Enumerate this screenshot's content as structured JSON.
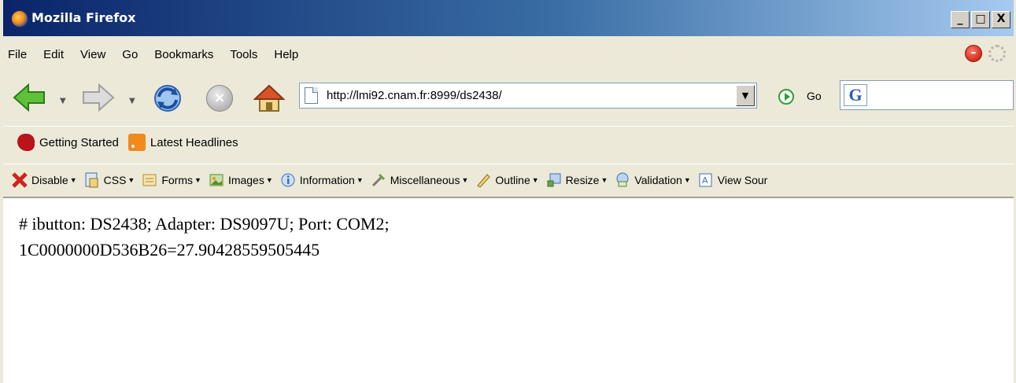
{
  "window": {
    "title": "Mozilla Firefox",
    "controls": [
      "_",
      "□",
      "X"
    ]
  },
  "menubar": {
    "items": [
      "File",
      "Edit",
      "View",
      "Go",
      "Bookmarks",
      "Tools",
      "Help"
    ]
  },
  "navbar": {
    "url": "http://lmi92.cnam.fr:8999/ds2438/",
    "go_label": "Go",
    "search_engine_letter": "G"
  },
  "bookmarks": {
    "items": [
      "Getting Started",
      "Latest Headlines"
    ]
  },
  "devbar": {
    "items": [
      "Disable",
      "CSS",
      "Forms",
      "Images",
      "Information",
      "Miscellaneous",
      "Outline",
      "Resize",
      "Validation",
      "View Sour"
    ]
  },
  "content": {
    "lines": [
      "# ibutton: DS2438; Adapter: DS9097U; Port: COM2;",
      "1C0000000D536B26=27.90428559505445"
    ]
  },
  "colors": {
    "titlebar_start": "#0a246a",
    "titlebar_end": "#a6caf0",
    "chrome": "#ece9d8",
    "go_green": "#2f9d36"
  }
}
